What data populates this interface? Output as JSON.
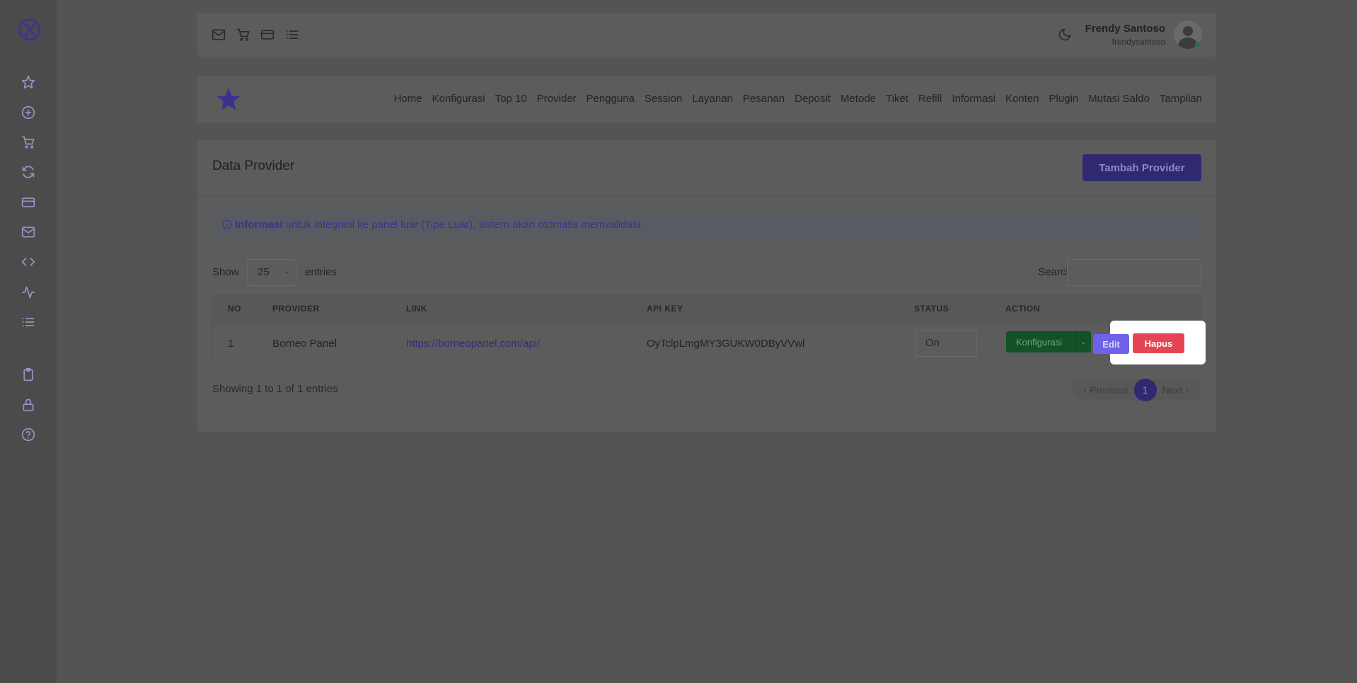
{
  "sidebar": {
    "logo": "app-logo",
    "icons": [
      "star-icon",
      "plus-circle-icon",
      "cart-icon",
      "refresh-icon",
      "credit-card-icon",
      "mail-icon",
      "code-icon",
      "activity-icon",
      "list-icon",
      "clipboard-icon",
      "lock-icon",
      "help-icon"
    ]
  },
  "topbar": {
    "icons": [
      "mail-icon",
      "cart-icon",
      "credit-card-icon",
      "list-icon"
    ],
    "theme_icon": "moon-icon",
    "user_name": "Frendy Santoso",
    "user_handle": "frendysantoso"
  },
  "navbar": {
    "links": [
      "Home",
      "Konfigurasi",
      "Top 10",
      "Provider",
      "Pengguna",
      "Session",
      "Layanan",
      "Pesanan",
      "Deposit",
      "Metode",
      "Tiket",
      "Refill",
      "Informasi",
      "Konten",
      "Plugin",
      "Mutasi Saldo",
      "Tampilan"
    ]
  },
  "card": {
    "title": "Data Provider",
    "add_button": "Tambah Provider",
    "alert_bold": "Informasi",
    "alert_text": "untuk integrasi ke panel luar (Tipe Luar), sistem akan otomatis memvalidasi.",
    "show_label": "Show",
    "entries_value": "25",
    "entries_label": "entries",
    "search_label": "Search:",
    "search_value": "",
    "columns": [
      "NO",
      "PROVIDER",
      "LINK",
      "API KEY",
      "STATUS",
      "ACTION"
    ],
    "rows": [
      {
        "no": "1",
        "provider": "Borneo Panel",
        "link": "https://borneopanel.com/api/",
        "api_key": "OyTclpLmgMY3GUKW0DByVVwl",
        "status": "On",
        "konfigurasi": "Konfigurasi",
        "edit": "Edit",
        "hapus": "Hapus"
      }
    ],
    "showing_text": "Showing 1 to 1 of 1 entries",
    "pager": {
      "previous": "Previous",
      "current": "1",
      "next": "Next"
    }
  },
  "colors": {
    "accent": "#2f2970",
    "danger": "#e54552",
    "success": "#125226",
    "edit": "#6d62e8"
  }
}
